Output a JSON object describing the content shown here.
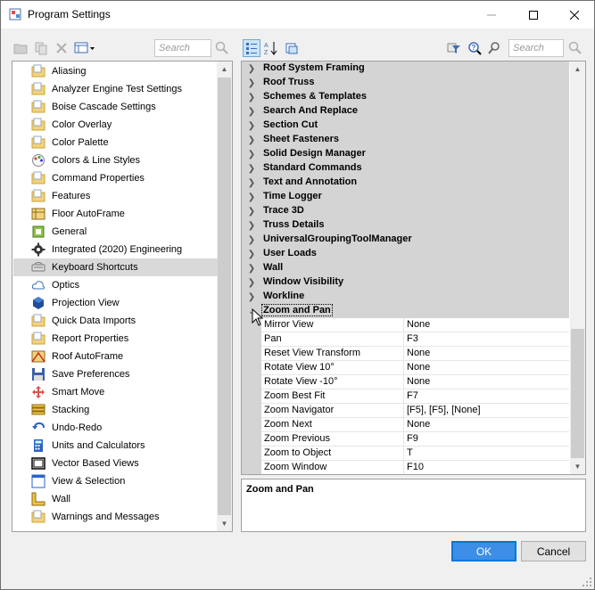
{
  "window": {
    "title": "Program Settings"
  },
  "toolbar_left": {
    "search_placeholder": "Search"
  },
  "toolbar_right": {
    "search_placeholder": "Search"
  },
  "tree": {
    "items": [
      {
        "label": "Aliasing",
        "icon": "folder-page-icon"
      },
      {
        "label": "Analyzer Engine Test Settings",
        "icon": "folder-page-icon"
      },
      {
        "label": "Boise Cascade Settings",
        "icon": "folder-page-icon"
      },
      {
        "label": "Color Overlay",
        "icon": "folder-page-icon"
      },
      {
        "label": "Color Palette",
        "icon": "folder-page-icon"
      },
      {
        "label": "Colors & Line Styles",
        "icon": "palette-icon"
      },
      {
        "label": "Command Properties",
        "icon": "folder-page-icon"
      },
      {
        "label": "Features",
        "icon": "folder-page-icon"
      },
      {
        "label": "Floor AutoFrame",
        "icon": "floor-frame-icon"
      },
      {
        "label": "General",
        "icon": "general-icon"
      },
      {
        "label": "Integrated (2020) Engineering",
        "icon": "gear-icon"
      },
      {
        "label": "Keyboard Shortcuts",
        "icon": "keyboard-icon",
        "selected": true
      },
      {
        "label": "Optics",
        "icon": "cloud-icon"
      },
      {
        "label": "Projection View",
        "icon": "cube-icon"
      },
      {
        "label": "Quick Data Imports",
        "icon": "folder-page-icon"
      },
      {
        "label": "Report Properties",
        "icon": "folder-page-icon"
      },
      {
        "label": "Roof AutoFrame",
        "icon": "roof-frame-icon"
      },
      {
        "label": "Save Preferences",
        "icon": "save-icon"
      },
      {
        "label": "Smart Move",
        "icon": "move-icon"
      },
      {
        "label": "Stacking",
        "icon": "stacking-icon"
      },
      {
        "label": "Undo-Redo",
        "icon": "undo-icon"
      },
      {
        "label": "Units and Calculators",
        "icon": "calculator-icon"
      },
      {
        "label": "Vector Based Views",
        "icon": "vector-view-icon"
      },
      {
        "label": "View & Selection",
        "icon": "view-selection-icon"
      },
      {
        "label": "Wall",
        "icon": "wall-icon"
      },
      {
        "label": "Warnings and Messages",
        "icon": "folder-page-icon"
      }
    ]
  },
  "categories": [
    {
      "label": "Roof System Framing"
    },
    {
      "label": "Roof Truss"
    },
    {
      "label": "Schemes & Templates"
    },
    {
      "label": "Search And Replace"
    },
    {
      "label": "Section Cut"
    },
    {
      "label": "Sheet Fasteners"
    },
    {
      "label": "Solid Design Manager"
    },
    {
      "label": "Standard Commands"
    },
    {
      "label": "Text and Annotation"
    },
    {
      "label": "Time Logger"
    },
    {
      "label": "Trace 3D"
    },
    {
      "label": "Truss Details"
    },
    {
      "label": "UniversalGroupingToolManager"
    },
    {
      "label": "User Loads"
    },
    {
      "label": "Wall"
    },
    {
      "label": "Window Visibility"
    },
    {
      "label": "Workline"
    }
  ],
  "expanded_category": {
    "label": "Zoom and Pan",
    "properties": [
      {
        "name": "Mirror View",
        "value": "None"
      },
      {
        "name": "Pan",
        "value": "F3"
      },
      {
        "name": "Reset View Transform",
        "value": "None"
      },
      {
        "name": "Rotate View 10°",
        "value": "None"
      },
      {
        "name": "Rotate View -10°",
        "value": "None"
      },
      {
        "name": "Zoom Best Fit",
        "value": "F7"
      },
      {
        "name": "Zoom Navigator",
        "value": "[F5], [F5], [None]"
      },
      {
        "name": "Zoom Next",
        "value": "None"
      },
      {
        "name": "Zoom Previous",
        "value": "F9"
      },
      {
        "name": "Zoom to Object",
        "value": "T"
      },
      {
        "name": "Zoom Window",
        "value": "F10"
      }
    ]
  },
  "description": {
    "title": "Zoom and Pan"
  },
  "buttons": {
    "ok": "OK",
    "cancel": "Cancel"
  },
  "colors": {
    "accent": "#0078d7",
    "category_bg": "#d4d4d4",
    "selected_bg": "#d9d9d9"
  }
}
